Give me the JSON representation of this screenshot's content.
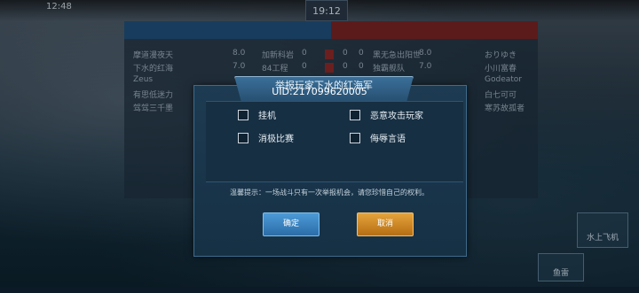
{
  "status_bar": {
    "time": "12:48",
    "timer": "19:12"
  },
  "scoreboard": {
    "blue_rows": [
      {
        "name": "摩道漫夜天",
        "score": "8.0",
        "col": "加新科岩",
        "v1": "0",
        "v2": "0"
      },
      {
        "name": "下水的红海",
        "score": "7.0",
        "col": "84工程",
        "v1": "0",
        "v2": "0"
      },
      {
        "name": "Zeus",
        "score": "",
        "col": "",
        "v1": "",
        "v2": ""
      },
      {
        "name": "有思低迷力",
        "score": "",
        "col": "",
        "v1": "",
        "v2": ""
      },
      {
        "name": "驾驾三千墨",
        "score": "",
        "col": "",
        "v1": "",
        "v2": ""
      }
    ],
    "red_rows": [
      {
        "name": "おりゆき",
        "score": "8.0",
        "col": "黑无急出阳世",
        "v": "0"
      },
      {
        "name": "小川富春",
        "score": "7.0",
        "col": "独霸舰队",
        "v": "0"
      },
      {
        "name": "Godeator",
        "score": "",
        "col": "",
        "v": ""
      },
      {
        "name": "白七可可",
        "score": "",
        "col": "",
        "v": ""
      },
      {
        "name": "寒苏故孤者",
        "score": "",
        "col": "",
        "v": ""
      }
    ]
  },
  "dialog": {
    "title": "举报玩家下水的红海军",
    "uid": "UID:217099620005",
    "options": [
      {
        "label": "挂机",
        "checked": false
      },
      {
        "label": "恶意攻击玩家",
        "checked": false
      },
      {
        "label": "消极比赛",
        "checked": false
      },
      {
        "label": "侮辱言语",
        "checked": false
      }
    ],
    "tip": "温馨提示：一场战斗只有一次举报机会，请您珍惜自己的权利。",
    "ok_label": "确定",
    "cancel_label": "取消"
  },
  "hud": {
    "torpedo_label": "鱼雷",
    "seaplane_label": "水上飞机"
  },
  "colors": {
    "blue_team": "#21507d",
    "red_team": "#7b2525",
    "ok": "#3a86c4",
    "cancel": "#d08a28"
  }
}
